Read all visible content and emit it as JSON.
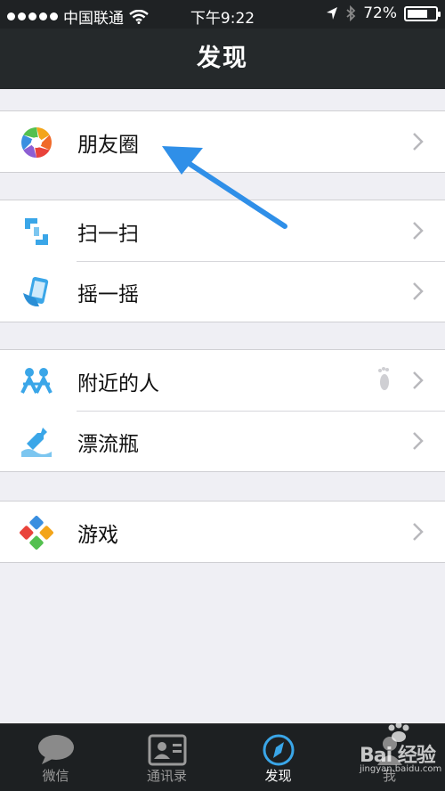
{
  "status_bar": {
    "carrier": "中国联通",
    "time": "下午9:22",
    "battery": "72%",
    "battery_level": 0.72
  },
  "nav": {
    "title": "发现"
  },
  "groups": [
    {
      "items": [
        {
          "label": "朋友圈",
          "icon": "moments-aperture-icon"
        }
      ]
    },
    {
      "items": [
        {
          "label": "扫一扫",
          "icon": "scan-icon"
        },
        {
          "label": "摇一摇",
          "icon": "shake-phone-icon"
        }
      ]
    },
    {
      "items": [
        {
          "label": "附近的人",
          "icon": "people-nearby-icon"
        },
        {
          "label": "漂流瓶",
          "icon": "drift-bottle-icon"
        }
      ]
    },
    {
      "items": [
        {
          "label": "游戏",
          "icon": "games-icon"
        }
      ]
    }
  ],
  "tabs": [
    {
      "label": "微信",
      "icon": "chat-bubble-icon",
      "active": false
    },
    {
      "label": "通讯录",
      "icon": "contacts-card-icon",
      "active": false
    },
    {
      "label": "发现",
      "icon": "compass-icon",
      "active": true
    },
    {
      "label": "我",
      "icon": "me-icon",
      "active": false
    }
  ],
  "watermark": {
    "main": "Bai 经验",
    "sub": "jingyan.baidu.com"
  },
  "colors": {
    "nav_bg": "#25292b",
    "accent_arrow": "#2f8fe8",
    "page_bg": "#efeff4"
  }
}
